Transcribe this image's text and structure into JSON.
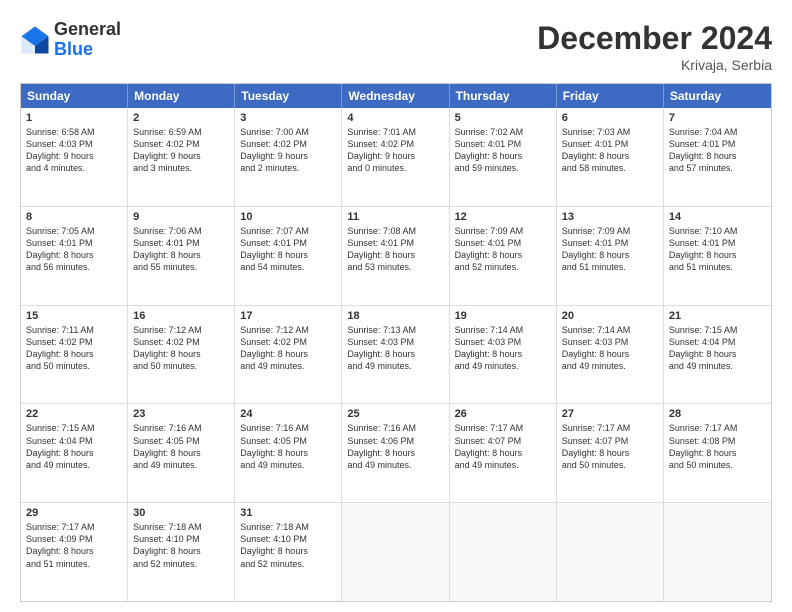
{
  "logo": {
    "general": "General",
    "blue": "Blue"
  },
  "title": "December 2024",
  "location": "Krivaja, Serbia",
  "days": [
    "Sunday",
    "Monday",
    "Tuesday",
    "Wednesday",
    "Thursday",
    "Friday",
    "Saturday"
  ],
  "rows": [
    [
      {
        "day": 1,
        "info": "Sunrise: 6:58 AM\nSunset: 4:03 PM\nDaylight: 9 hours\nand 4 minutes."
      },
      {
        "day": 2,
        "info": "Sunrise: 6:59 AM\nSunset: 4:02 PM\nDaylight: 9 hours\nand 3 minutes."
      },
      {
        "day": 3,
        "info": "Sunrise: 7:00 AM\nSunset: 4:02 PM\nDaylight: 9 hours\nand 2 minutes."
      },
      {
        "day": 4,
        "info": "Sunrise: 7:01 AM\nSunset: 4:02 PM\nDaylight: 9 hours\nand 0 minutes."
      },
      {
        "day": 5,
        "info": "Sunrise: 7:02 AM\nSunset: 4:01 PM\nDaylight: 8 hours\nand 59 minutes."
      },
      {
        "day": 6,
        "info": "Sunrise: 7:03 AM\nSunset: 4:01 PM\nDaylight: 8 hours\nand 58 minutes."
      },
      {
        "day": 7,
        "info": "Sunrise: 7:04 AM\nSunset: 4:01 PM\nDaylight: 8 hours\nand 57 minutes."
      }
    ],
    [
      {
        "day": 8,
        "info": "Sunrise: 7:05 AM\nSunset: 4:01 PM\nDaylight: 8 hours\nand 56 minutes."
      },
      {
        "day": 9,
        "info": "Sunrise: 7:06 AM\nSunset: 4:01 PM\nDaylight: 8 hours\nand 55 minutes."
      },
      {
        "day": 10,
        "info": "Sunrise: 7:07 AM\nSunset: 4:01 PM\nDaylight: 8 hours\nand 54 minutes."
      },
      {
        "day": 11,
        "info": "Sunrise: 7:08 AM\nSunset: 4:01 PM\nDaylight: 8 hours\nand 53 minutes."
      },
      {
        "day": 12,
        "info": "Sunrise: 7:09 AM\nSunset: 4:01 PM\nDaylight: 8 hours\nand 52 minutes."
      },
      {
        "day": 13,
        "info": "Sunrise: 7:09 AM\nSunset: 4:01 PM\nDaylight: 8 hours\nand 51 minutes."
      },
      {
        "day": 14,
        "info": "Sunrise: 7:10 AM\nSunset: 4:01 PM\nDaylight: 8 hours\nand 51 minutes."
      }
    ],
    [
      {
        "day": 15,
        "info": "Sunrise: 7:11 AM\nSunset: 4:02 PM\nDaylight: 8 hours\nand 50 minutes."
      },
      {
        "day": 16,
        "info": "Sunrise: 7:12 AM\nSunset: 4:02 PM\nDaylight: 8 hours\nand 50 minutes."
      },
      {
        "day": 17,
        "info": "Sunrise: 7:12 AM\nSunset: 4:02 PM\nDaylight: 8 hours\nand 49 minutes."
      },
      {
        "day": 18,
        "info": "Sunrise: 7:13 AM\nSunset: 4:03 PM\nDaylight: 8 hours\nand 49 minutes."
      },
      {
        "day": 19,
        "info": "Sunrise: 7:14 AM\nSunset: 4:03 PM\nDaylight: 8 hours\nand 49 minutes."
      },
      {
        "day": 20,
        "info": "Sunrise: 7:14 AM\nSunset: 4:03 PM\nDaylight: 8 hours\nand 49 minutes."
      },
      {
        "day": 21,
        "info": "Sunrise: 7:15 AM\nSunset: 4:04 PM\nDaylight: 8 hours\nand 49 minutes."
      }
    ],
    [
      {
        "day": 22,
        "info": "Sunrise: 7:15 AM\nSunset: 4:04 PM\nDaylight: 8 hours\nand 49 minutes."
      },
      {
        "day": 23,
        "info": "Sunrise: 7:16 AM\nSunset: 4:05 PM\nDaylight: 8 hours\nand 49 minutes."
      },
      {
        "day": 24,
        "info": "Sunrise: 7:16 AM\nSunset: 4:05 PM\nDaylight: 8 hours\nand 49 minutes."
      },
      {
        "day": 25,
        "info": "Sunrise: 7:16 AM\nSunset: 4:06 PM\nDaylight: 8 hours\nand 49 minutes."
      },
      {
        "day": 26,
        "info": "Sunrise: 7:17 AM\nSunset: 4:07 PM\nDaylight: 8 hours\nand 49 minutes."
      },
      {
        "day": 27,
        "info": "Sunrise: 7:17 AM\nSunset: 4:07 PM\nDaylight: 8 hours\nand 50 minutes."
      },
      {
        "day": 28,
        "info": "Sunrise: 7:17 AM\nSunset: 4:08 PM\nDaylight: 8 hours\nand 50 minutes."
      }
    ],
    [
      {
        "day": 29,
        "info": "Sunrise: 7:17 AM\nSunset: 4:09 PM\nDaylight: 8 hours\nand 51 minutes."
      },
      {
        "day": 30,
        "info": "Sunrise: 7:18 AM\nSunset: 4:10 PM\nDaylight: 8 hours\nand 52 minutes."
      },
      {
        "day": 31,
        "info": "Sunrise: 7:18 AM\nSunset: 4:10 PM\nDaylight: 8 hours\nand 52 minutes."
      },
      null,
      null,
      null,
      null
    ]
  ]
}
